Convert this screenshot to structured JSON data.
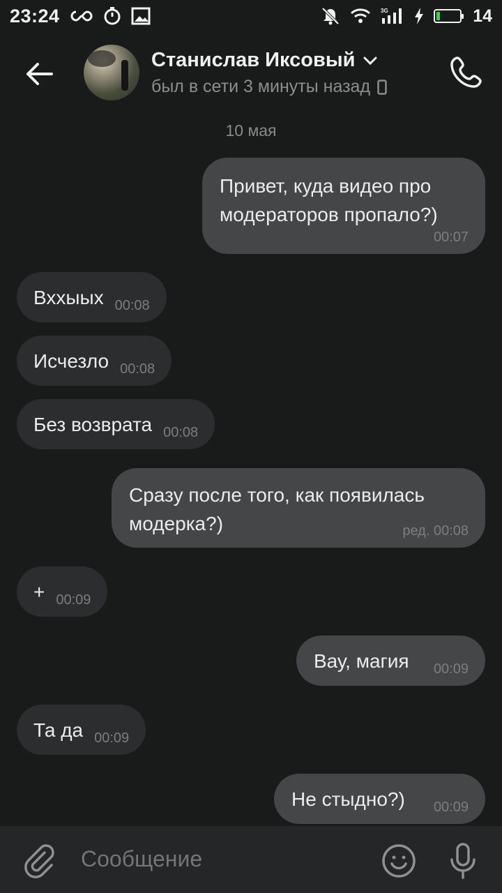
{
  "status_bar": {
    "time": "23:24",
    "battery_level": "14",
    "icons": [
      "infinity-icon",
      "timer-icon",
      "image-icon",
      "muted-bell-icon",
      "wifi-icon",
      "signal-3g-icon",
      "charging-icon",
      "battery-icon"
    ],
    "battery_color": "#3fcf4a"
  },
  "header": {
    "contact_name": "Станислав Иксовый",
    "status": "был в сети 3 минуты назад"
  },
  "date_separator": "10 мая",
  "messages": [
    {
      "dir": "out",
      "text": "Привет, куда видео про\nмодераторов пропало?)",
      "time": "00:07"
    },
    {
      "dir": "in",
      "text": "Вххыых",
      "time": "00:08"
    },
    {
      "dir": "in",
      "text": "Исчезло",
      "time": "00:08"
    },
    {
      "dir": "in",
      "text": "Без возврата",
      "time": "00:08"
    },
    {
      "dir": "out",
      "text": "Сразу после того, как появилась\nмодерка?)",
      "time": "ред. 00:08"
    },
    {
      "dir": "in",
      "text": "+",
      "time": "00:09"
    },
    {
      "dir": "out",
      "text": "Вау, магия",
      "time": "00:09"
    },
    {
      "dir": "in",
      "text": "Та да",
      "time": "00:09"
    },
    {
      "dir": "out",
      "text": "Не стыдно?)",
      "time": "00:09"
    }
  ],
  "composer": {
    "placeholder": "Сообщение"
  },
  "colors": {
    "background": "#191a1a",
    "incoming_bubble": "#2c2d2e",
    "outgoing_bubble": "#454647",
    "composer": "#252627"
  }
}
